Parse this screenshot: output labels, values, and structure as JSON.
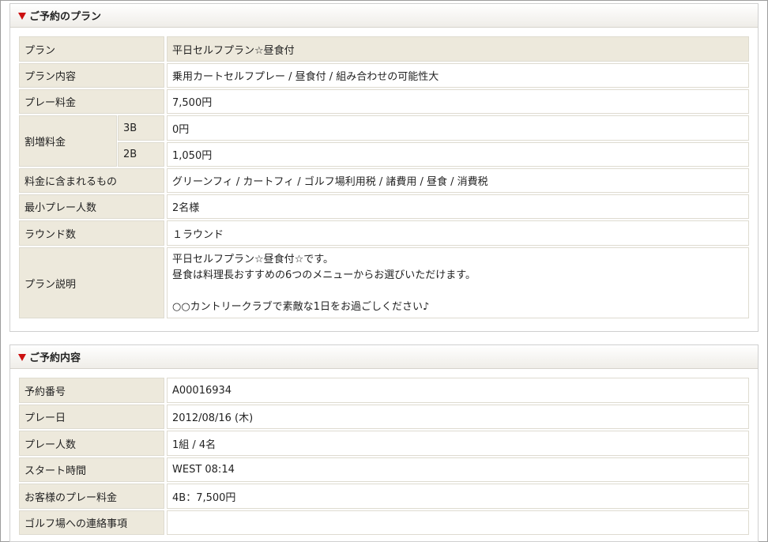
{
  "plan_section": {
    "title": "ご予約のプラン",
    "rows": {
      "plan": {
        "label": "プラン",
        "value": "平日セルフプラン☆昼食付"
      },
      "content": {
        "label": "プラン内容",
        "value": "乗用カートセルフプレー / 昼食付 / 組み合わせの可能性大"
      },
      "fee": {
        "label": "プレー料金",
        "value": "7,500円"
      },
      "surcharge": {
        "label": "割増料金",
        "sub": [
          {
            "label": "3B",
            "value": "0円"
          },
          {
            "label": "2B",
            "value": "1,050円"
          }
        ]
      },
      "included": {
        "label": "料金に含まれるもの",
        "value": "グリーンフィ / カートフィ / ゴルフ場利用税 / 諸費用 / 昼食 / 消費税"
      },
      "min_players": {
        "label": "最小プレー人数",
        "value": "2名様"
      },
      "rounds": {
        "label": "ラウンド数",
        "value": "１ラウンド"
      },
      "description": {
        "label": "プラン説明",
        "lines": [
          "平日セルフプラン☆昼食付☆です。",
          "昼食は料理長おすすめの6つのメニューからお選びいただけます。",
          "",
          "○○カントリークラブで素敵な1日をお過ごしください♪"
        ]
      }
    }
  },
  "reservation_section": {
    "title": "ご予約内容",
    "rows": {
      "number": {
        "label": "予約番号",
        "value": "A00016934"
      },
      "date": {
        "label": "プレー日",
        "value": "2012/08/16 (木)"
      },
      "players": {
        "label": "プレー人数",
        "value": "1組 / 4名"
      },
      "start": {
        "label": "スタート時間",
        "value": "WEST 08:14"
      },
      "price": {
        "label": "お客様のプレー料金",
        "value": "4B：7,500円"
      },
      "notes": {
        "label": "ゴルフ場への連絡事項",
        "value": ""
      }
    }
  },
  "colors": {
    "accent": "#cc1010",
    "label_bg": "#ede9dc",
    "border": "#dedbd0"
  }
}
